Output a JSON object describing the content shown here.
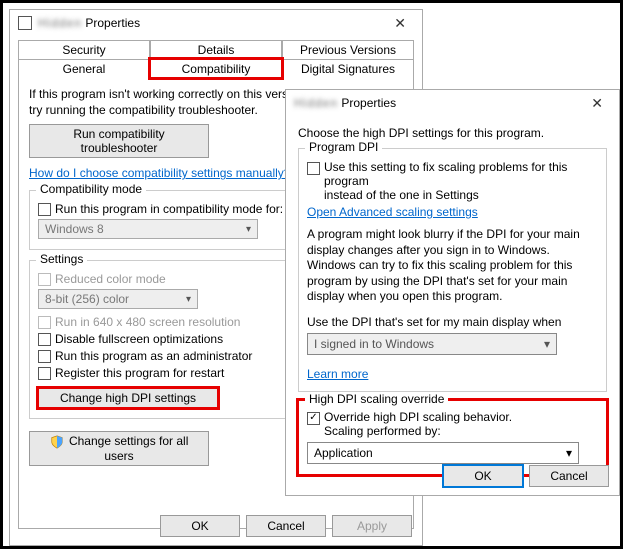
{
  "dialog1": {
    "title_suffix": "Properties",
    "tabs": {
      "row1": [
        "Security",
        "Details",
        "Previous Versions"
      ],
      "row2": [
        "General",
        "Compatibility",
        "Digital Signatures"
      ]
    },
    "desc": "If this program isn't working correctly on this version of ...",
    "desc2": "try running the compatibility troubleshooter.",
    "run_troubleshooter": "Run compatibility troubleshooter",
    "help_link": "How do I choose compatibility settings manually?",
    "compat_mode": {
      "legend": "Compatibility mode",
      "chk": "Run this program in compatibility mode for:",
      "select": "Windows 8"
    },
    "settings": {
      "legend": "Settings",
      "reduced_color": "Reduced color mode",
      "color_select": "8-bit (256) color",
      "low_res": "Run in 640 x 480 screen resolution",
      "disable_fullscreen": "Disable fullscreen optimizations",
      "run_admin": "Run this program as an administrator",
      "register_restart": "Register this program for restart",
      "change_dpi": "Change high DPI settings"
    },
    "change_all_users": "Change settings for all users",
    "ok": "OK",
    "cancel": "Cancel",
    "apply": "Apply"
  },
  "dialog2": {
    "title_suffix": "Properties",
    "heading": "Choose the high DPI settings for this program.",
    "program_dpi": {
      "legend": "Program DPI",
      "chk_line1": "Use this setting to fix scaling problems for this program",
      "chk_line2": "instead of the one in Settings",
      "adv_link": "Open Advanced scaling settings",
      "para": "A program might look blurry if the DPI for your main display changes after you sign in to Windows. Windows can try to fix this scaling problem for this program by using the DPI that's set for your main display when you open this program.",
      "use_dpi_label": "Use the DPI that's set for my main display when",
      "use_dpi_select": "I signed in to Windows",
      "learn_more": "Learn more"
    },
    "override": {
      "legend": "High DPI scaling override",
      "chk_line1": "Override high DPI scaling behavior.",
      "chk_line2": "Scaling performed by:",
      "select": "Application"
    },
    "ok": "OK",
    "cancel": "Cancel"
  }
}
